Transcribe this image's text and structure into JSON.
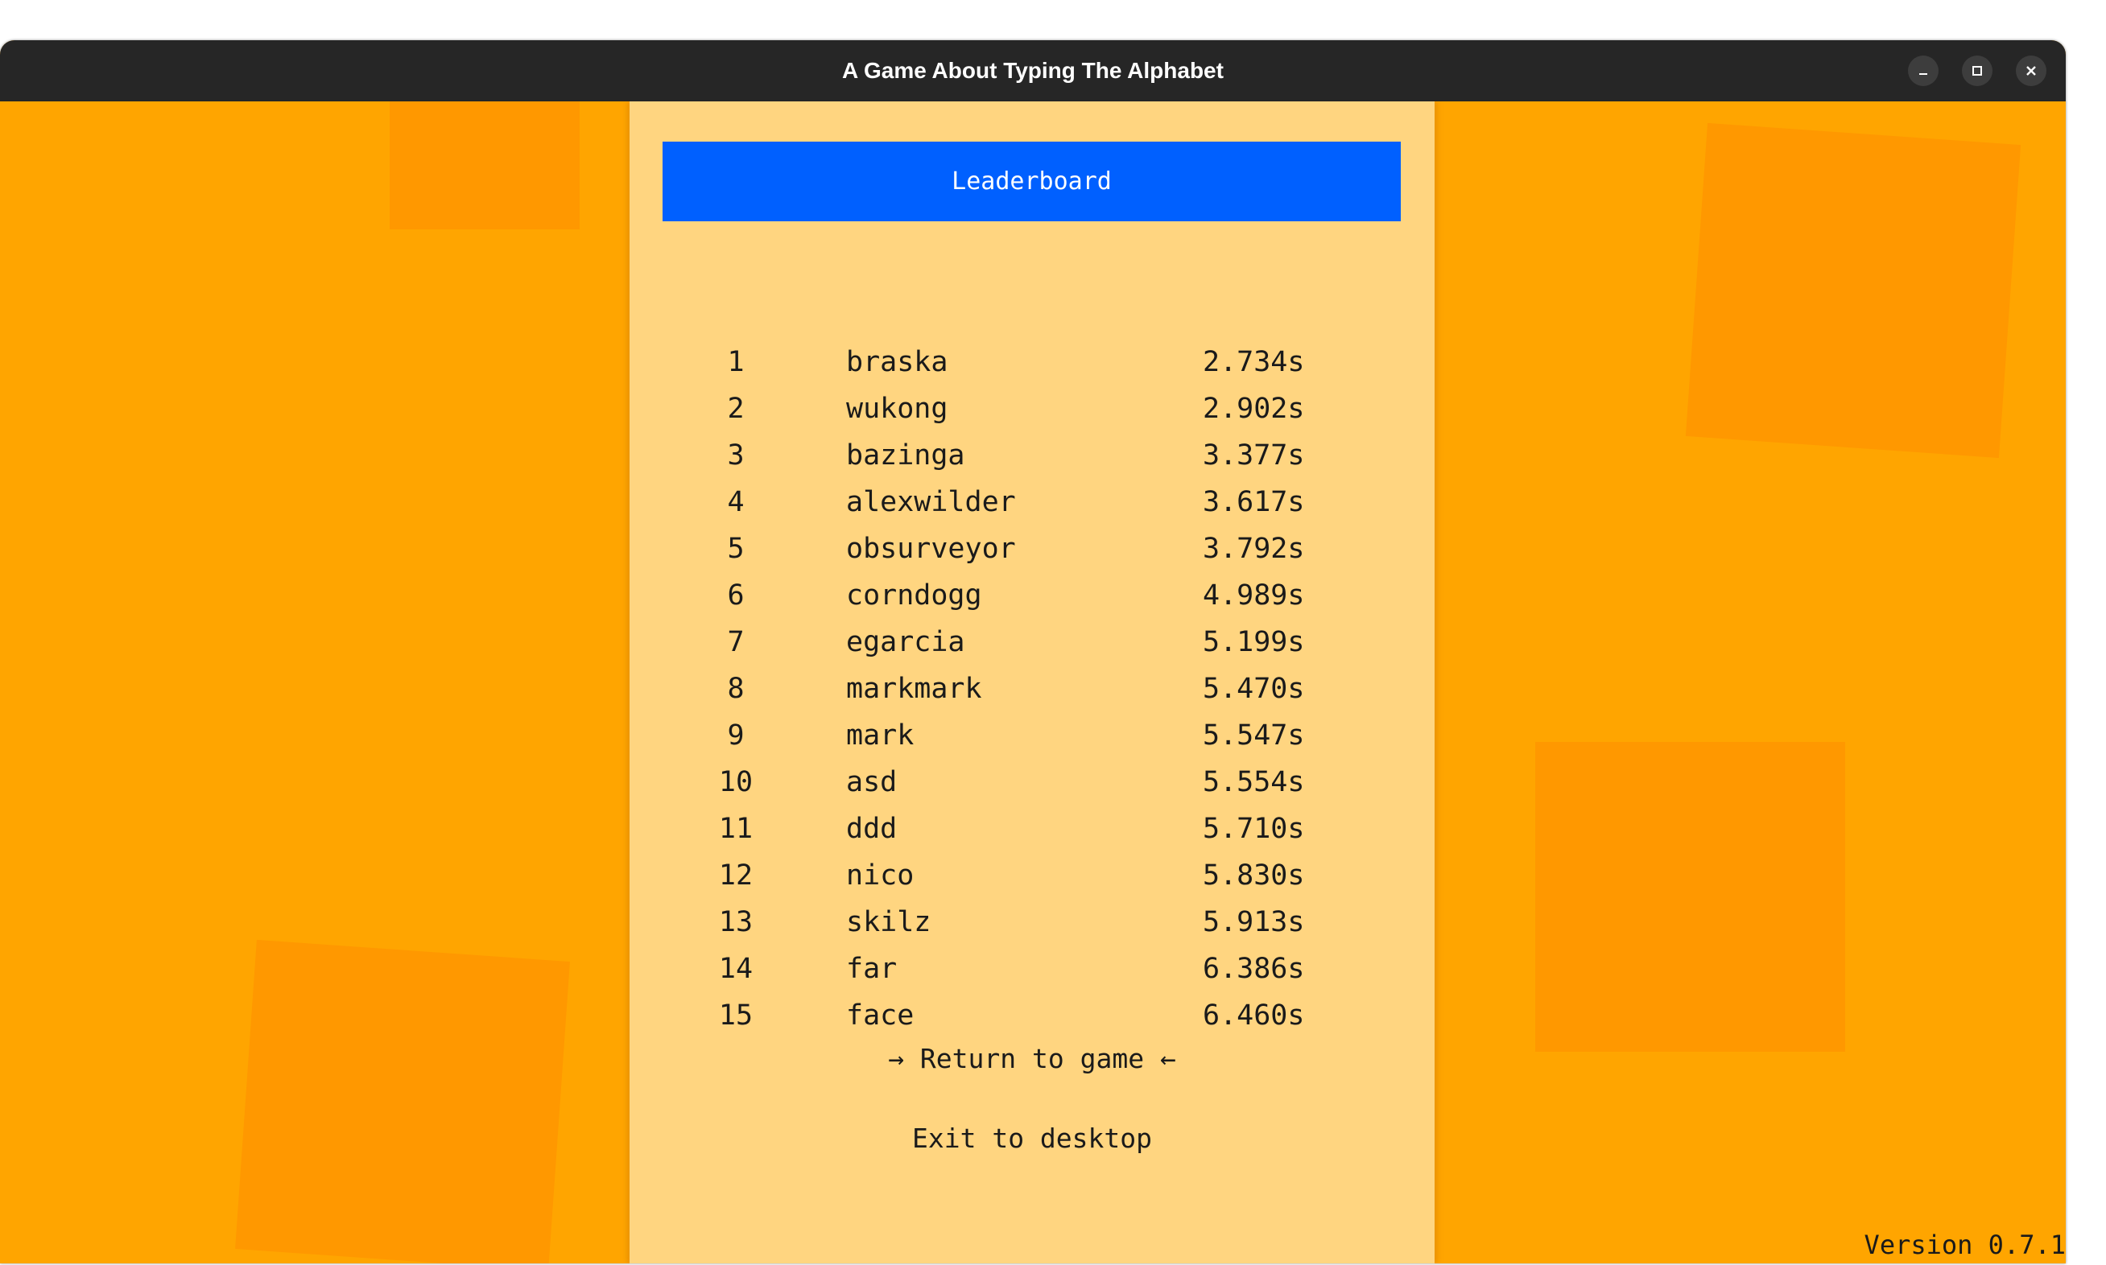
{
  "window": {
    "title": "A Game About Typing The Alphabet",
    "minimize_icon": "minimize-icon",
    "maximize_icon": "maximize-icon",
    "close_icon": "close-icon"
  },
  "colors": {
    "background": "#ffa500",
    "panel": "#ffd580",
    "header": "#0060ff",
    "titlebar": "#262626"
  },
  "leaderboard": {
    "title": "Leaderboard",
    "entries": [
      {
        "rank": "1",
        "name": "braska",
        "time": "2.734s"
      },
      {
        "rank": "2",
        "name": "wukong",
        "time": "2.902s"
      },
      {
        "rank": "3",
        "name": "bazinga",
        "time": "3.377s"
      },
      {
        "rank": "4",
        "name": "alexwilder",
        "time": "3.617s"
      },
      {
        "rank": "5",
        "name": "obsurveyor",
        "time": "3.792s"
      },
      {
        "rank": "6",
        "name": "corndogg",
        "time": "4.989s"
      },
      {
        "rank": "7",
        "name": "egarcia",
        "time": "5.199s"
      },
      {
        "rank": "8",
        "name": "markmark",
        "time": "5.470s"
      },
      {
        "rank": "9",
        "name": "mark",
        "time": "5.547s"
      },
      {
        "rank": "10",
        "name": "asd",
        "time": "5.554s"
      },
      {
        "rank": "11",
        "name": "ddd",
        "time": "5.710s"
      },
      {
        "rank": "12",
        "name": "nico",
        "time": "5.830s"
      },
      {
        "rank": "13",
        "name": "skilz",
        "time": "5.913s"
      },
      {
        "rank": "14",
        "name": "far",
        "time": "6.386s"
      },
      {
        "rank": "15",
        "name": "face",
        "time": "6.460s"
      }
    ]
  },
  "menu": {
    "return_label": "→ Return to game ←",
    "exit_label": "Exit to desktop"
  },
  "footer": {
    "version": "Version 0.7.1"
  }
}
